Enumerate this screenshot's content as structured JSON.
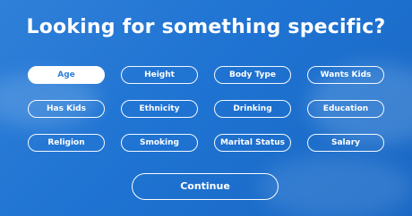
{
  "title": "Looking for something specific?",
  "filters": [
    {
      "label": "Age",
      "selected": true
    },
    {
      "label": "Height",
      "selected": false
    },
    {
      "label": "Body Type",
      "selected": false
    },
    {
      "label": "Wants Kids",
      "selected": false
    },
    {
      "label": "Has Kids",
      "selected": false
    },
    {
      "label": "Ethnicity",
      "selected": false
    },
    {
      "label": "Drinking",
      "selected": false
    },
    {
      "label": "Education",
      "selected": false
    },
    {
      "label": "Religion",
      "selected": false
    },
    {
      "label": "Smoking",
      "selected": false
    },
    {
      "label": "Marital Status",
      "selected": false
    },
    {
      "label": "Salary",
      "selected": false
    }
  ],
  "actions": {
    "continue_label": "Continue"
  },
  "colors": {
    "background": "#1f73d2",
    "accent": "#ffffff",
    "selected_text": "#2f80d8"
  }
}
